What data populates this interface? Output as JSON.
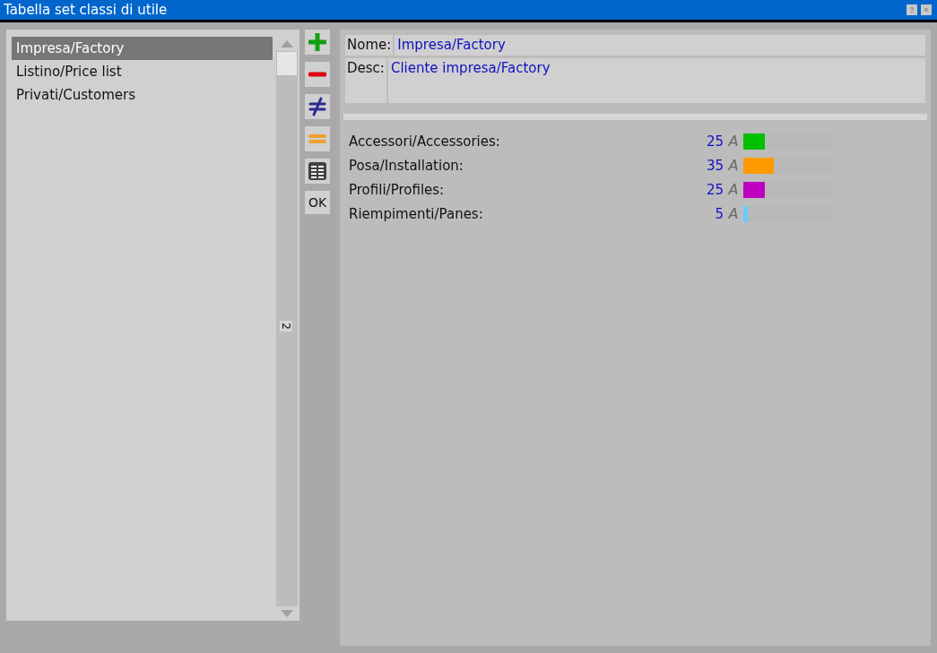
{
  "window": {
    "title": "Tabella set classi di utile",
    "buttons": [
      "?",
      "×"
    ]
  },
  "list": {
    "items": [
      {
        "label": "Impresa/Factory",
        "selected": true
      },
      {
        "label": "Listino/Price list",
        "selected": false
      },
      {
        "label": "Privati/Customers",
        "selected": false
      }
    ],
    "scroll_label": "2"
  },
  "toolbar": [
    {
      "kind": "add"
    },
    {
      "kind": "remove"
    },
    {
      "kind": "not-equal"
    },
    {
      "kind": "equal"
    },
    {
      "kind": "table"
    },
    {
      "kind": "ok",
      "label": "OK"
    }
  ],
  "form": {
    "name_label": "Nome:",
    "name": "Impresa/Factory",
    "desc_label": "Desc:",
    "desc": "Cliente impresa/Factory"
  },
  "classes": [
    {
      "name": "Accessori/Accessories:",
      "value": "25",
      "font_glyph": "A",
      "level": 0.25,
      "color": "#00c000"
    },
    {
      "name": "Posa/Installation:",
      "value": "35",
      "font_glyph": "A",
      "level": 0.35,
      "color": "#ff9900"
    },
    {
      "name": "Profili/Profiles:",
      "value": "25",
      "font_glyph": "A",
      "level": 0.25,
      "color": "#c000c0"
    },
    {
      "name": "Riempimenti/Panes:",
      "value": "5",
      "font_glyph": "A",
      "level": 0.05,
      "color": "#66ccff"
    }
  ]
}
